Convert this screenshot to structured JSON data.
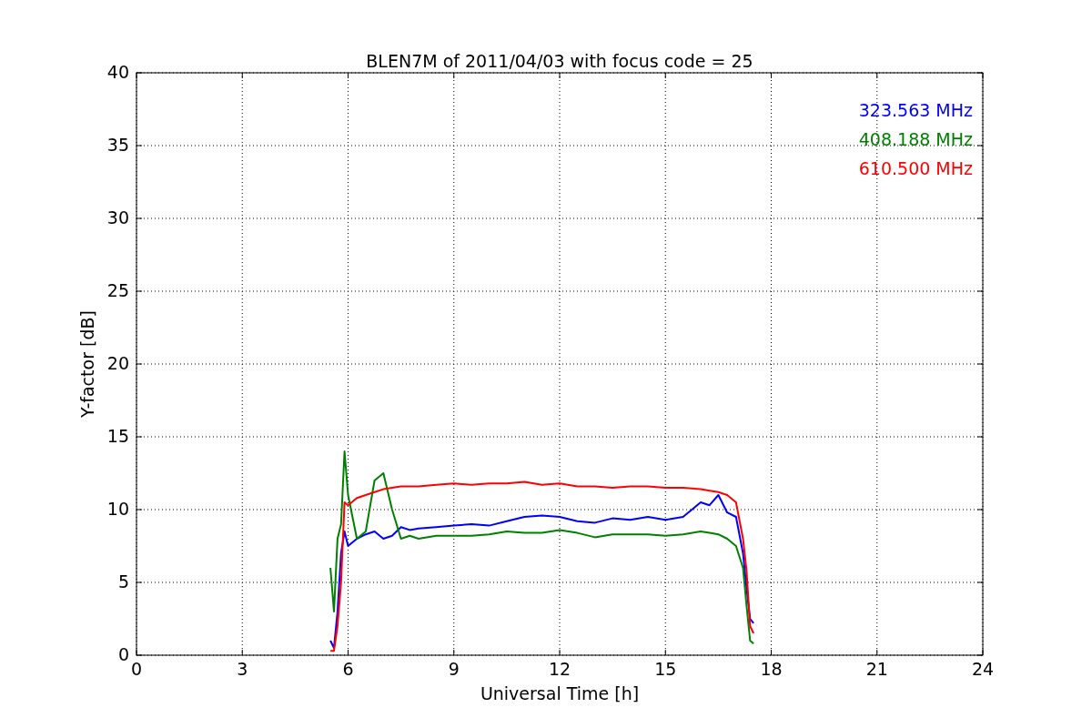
{
  "figure": {
    "chart_data": {
      "type": "line",
      "title": "BLEN7M of 2011/04/03 with focus code = 25",
      "xlabel": "Universal Time [h]",
      "ylabel": "Y-factor [dB]",
      "x": [
        5.5,
        5.6,
        5.7,
        5.8,
        5.9,
        6.0,
        6.25,
        6.5,
        6.75,
        7.0,
        7.25,
        7.5,
        7.75,
        8,
        8.5,
        9,
        9.5,
        10,
        10.5,
        11,
        11.5,
        12,
        12.5,
        13,
        13.5,
        14,
        14.5,
        15,
        15.5,
        16,
        16.25,
        16.5,
        16.75,
        17,
        17.2,
        17.3,
        17.4,
        17.5
      ],
      "series": [
        {
          "name": "323.563 MHz",
          "color": "#0000ff",
          "values": [
            1,
            0.5,
            3,
            7,
            8.5,
            7.5,
            8,
            8.3,
            8.5,
            8,
            8.2,
            8.8,
            8.6,
            8.7,
            8.8,
            8.9,
            9,
            8.9,
            9.2,
            9.5,
            9.6,
            9.5,
            9.2,
            9.1,
            9.4,
            9.3,
            9.5,
            9.3,
            9.5,
            10.5,
            10.3,
            11,
            9.8,
            9.5,
            7,
            4.6,
            2.5,
            2.2
          ]
        },
        {
          "name": "408.188 MHz",
          "color": "#008000",
          "values": [
            6,
            3,
            8,
            9,
            14,
            11,
            8,
            8.5,
            12,
            12.5,
            10,
            8,
            8.2,
            8,
            8.2,
            8.2,
            8.2,
            8.3,
            8.5,
            8.4,
            8.4,
            8.6,
            8.4,
            8.1,
            8.3,
            8.3,
            8.3,
            8.2,
            8.3,
            8.5,
            8.4,
            8.3,
            8.0,
            7.5,
            6,
            3.4,
            1,
            0.8
          ]
        },
        {
          "name": "610.500 MHz",
          "color": "#ff0000",
          "values": [
            0.3,
            0.3,
            2,
            5,
            10.5,
            10.3,
            10.8,
            11,
            11.2,
            11.4,
            11.5,
            11.6,
            11.6,
            11.6,
            11.7,
            11.8,
            11.7,
            11.8,
            11.8,
            11.9,
            11.7,
            11.8,
            11.6,
            11.6,
            11.5,
            11.6,
            11.6,
            11.5,
            11.5,
            11.4,
            11.3,
            11.2,
            11,
            10.5,
            8,
            5.8,
            2,
            1.5
          ]
        }
      ],
      "xlim": [
        0,
        24
      ],
      "ylim": [
        0,
        40
      ],
      "grid": true,
      "xticks": [
        0,
        3,
        6,
        9,
        12,
        15,
        18,
        21,
        24
      ],
      "yticks": [
        0,
        5,
        10,
        15,
        20,
        25,
        30,
        35,
        40
      ]
    }
  }
}
